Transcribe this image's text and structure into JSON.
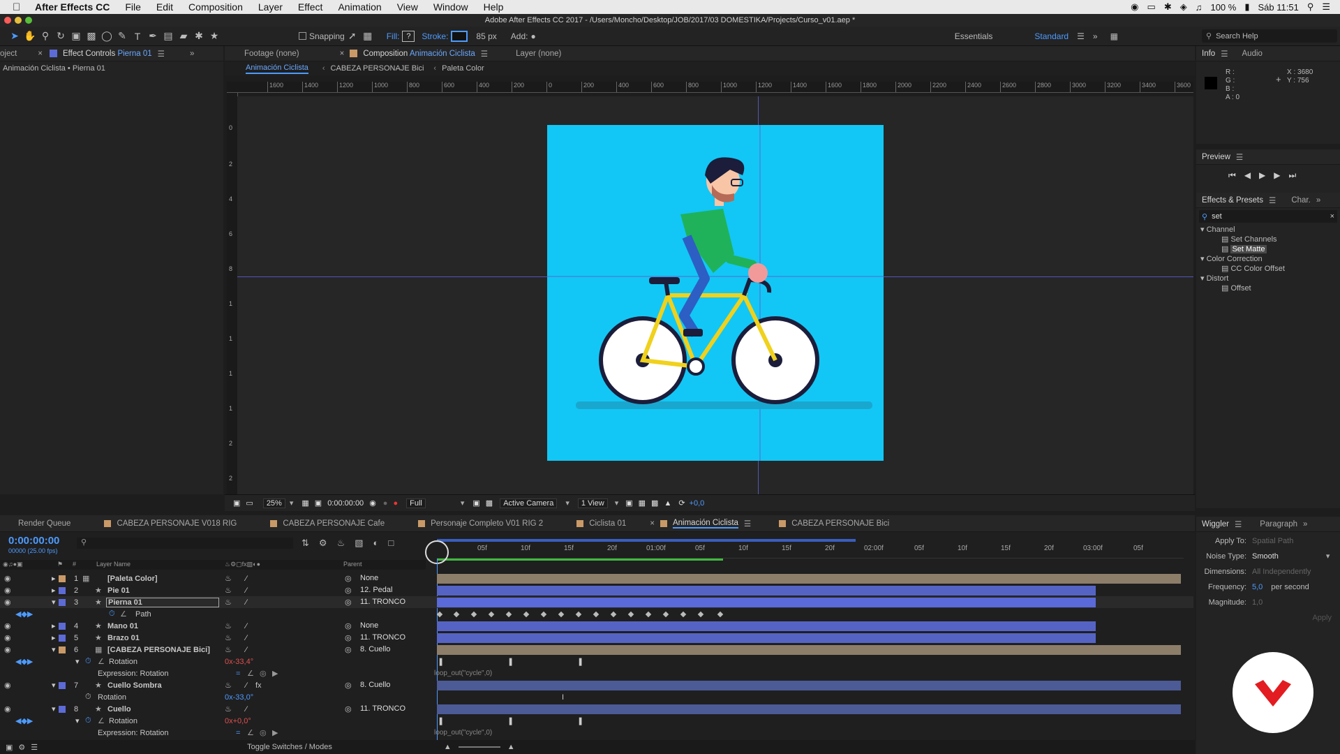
{
  "menubar": {
    "app_name": "After Effects CC",
    "items": [
      "File",
      "Edit",
      "Composition",
      "Layer",
      "Effect",
      "Animation",
      "View",
      "Window",
      "Help"
    ],
    "battery": "100 %",
    "clock": "Sáb 11:51"
  },
  "window_title": "Adobe After Effects CC 2017 - /Users/Moncho/Desktop/JOB/2017/03 DOMESTIKA/Projects/Curso_v01.aep *",
  "toolbar": {
    "snapping": "Snapping",
    "fill": "Fill:",
    "stroke": "Stroke:",
    "stroke_px": "85 px",
    "add": "Add:",
    "workspace_essentials": "Essentials",
    "workspace_standard": "Standard",
    "search_help": "Search Help"
  },
  "left_panel": {
    "tab_project": "oject",
    "tab_effect_controls_prefix": "Effect Controls",
    "tab_effect_controls_layer": "Pierna 01",
    "breadcrumb": "Animación Ciclista • Pierna 01"
  },
  "viewer": {
    "tab_footage": "Footage (none)",
    "tab_comp_prefix": "Composition",
    "tab_comp_name": "Animación Ciclista",
    "tab_layer": "Layer (none)",
    "subtabs": [
      "Animación Ciclista",
      "CABEZA PERSONAJE Bici",
      "Paleta Color"
    ],
    "ruler_h": [
      "1600",
      "1400",
      "1200",
      "1000",
      "800",
      "600",
      "400",
      "200",
      "0",
      "200",
      "400",
      "600",
      "800",
      "1000",
      "1200",
      "1400",
      "1600",
      "1800",
      "2000",
      "2200",
      "2400",
      "2600",
      "2800",
      "3000",
      "3200",
      "3400",
      "3600"
    ],
    "ruler_v": [
      "0",
      "2",
      "4",
      "6",
      "8",
      "1",
      "1",
      "1",
      "1",
      "2",
      "2"
    ],
    "zoom": "25%",
    "timecode": "0:00:00:00",
    "resolution": "Full",
    "camera": "Active Camera",
    "views": "1 View",
    "exposure": "+0,0",
    "bg_color": "#12c7f5"
  },
  "info_panel": {
    "tab_info": "Info",
    "tab_audio": "Audio",
    "r": "R :",
    "g": "G :",
    "b": "B :",
    "a": "A : 0",
    "x": "X : 3680",
    "y": "Y : 756"
  },
  "preview_panel": {
    "title": "Preview"
  },
  "effects_panel": {
    "tab": "Effects & Presets",
    "tab2": "Char.",
    "search": "set",
    "groups": [
      {
        "name": "Channel",
        "items": [
          "Set Channels",
          "Set Matte"
        ]
      },
      {
        "name": "Color Correction",
        "items": [
          "CC Color Offset"
        ]
      },
      {
        "name": "Distort",
        "items": [
          "Offset"
        ]
      }
    ]
  },
  "wiggler_panel": {
    "tab": "Wiggler",
    "tab2": "Paragraph",
    "apply_to_label": "Apply To:",
    "apply_to_value": "Spatial Path",
    "noise_label": "Noise Type:",
    "noise_value": "Smooth",
    "dimensions_label": "Dimensions:",
    "dimensions_value": "All Independently",
    "frequency_label": "Frequency:",
    "frequency_value": "5,0",
    "frequency_unit": "per second",
    "magnitude_label": "Magnitude:",
    "magnitude_value": "1,0",
    "apply_btn": "Apply"
  },
  "timeline": {
    "tabs": [
      "Render Queue",
      "CABEZA PERSONAJE V018 RIG",
      "CABEZA PERSONAJE Cafe",
      "Personaje Completo V01 RIG 2",
      "Ciclista 01",
      "Animación Ciclista",
      "CABEZA PERSONAJE Bici"
    ],
    "active_tab": 5,
    "timecode": "0:00:00:00",
    "fps": "00000 (25.00 fps)",
    "col_layer_name": "Layer Name",
    "col_parent": "Parent",
    "col_num": "#",
    "ruler": [
      "05f",
      "10f",
      "15f",
      "20f",
      "01:00f",
      "05f",
      "10f",
      "15f",
      "20f",
      "02:00f",
      "05f",
      "10f",
      "15f",
      "20f",
      "03:00f",
      "05f"
    ],
    "layers": [
      {
        "num": "1",
        "name": "[Paleta Color]",
        "parent": "None"
      },
      {
        "num": "2",
        "name": "Pie 01",
        "parent": "12. Pedal"
      },
      {
        "num": "3",
        "name": "Pierna 01",
        "parent": "11. TRONCO"
      },
      {
        "num": "",
        "name": "Path",
        "parent": ""
      },
      {
        "num": "4",
        "name": "Mano 01",
        "parent": "None"
      },
      {
        "num": "5",
        "name": "Brazo 01",
        "parent": "11. TRONCO"
      },
      {
        "num": "6",
        "name": "[CABEZA PERSONAJE Bici]",
        "parent": "8. Cuello"
      },
      {
        "num": "",
        "name": "Rotation",
        "parent": ""
      },
      {
        "num": "",
        "name": "Expression: Rotation",
        "parent": ""
      },
      {
        "num": "7",
        "name": "Cuello Sombra",
        "parent": "8. Cuello"
      },
      {
        "num": "",
        "name": "Rotation",
        "parent": ""
      },
      {
        "num": "8",
        "name": "Cuello",
        "parent": "11. TRONCO"
      },
      {
        "num": "",
        "name": "Rotation",
        "parent": ""
      },
      {
        "num": "",
        "name": "Expression: Rotation",
        "parent": ""
      }
    ],
    "rotation_6": "0x-33,4°",
    "rotation_7": "0x-33,0°",
    "rotation_8": "0x+0,0°",
    "expression": "loop_out(\"cycle\",0)",
    "toggle": "Toggle Switches / Modes"
  }
}
